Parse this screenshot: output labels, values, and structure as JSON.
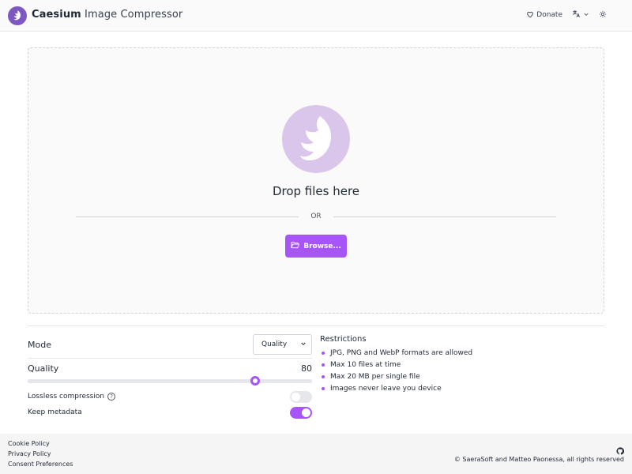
{
  "header": {
    "brand_strong": "Caesium",
    "brand_rest": " Image Compressor",
    "donate_label": "Donate",
    "icons": [
      "caesium-logo-icon",
      "heart-icon",
      "translate-icon",
      "chevron-down-icon",
      "theme-icon"
    ]
  },
  "dropzone": {
    "title": "Drop files here",
    "or_label": "OR",
    "browse_label": "Browse...",
    "icons": [
      "bird-logo-icon",
      "folder-open-icon"
    ]
  },
  "settings": {
    "mode_label": "Mode",
    "mode_value": "Quality",
    "quality_label": "Quality",
    "quality_value": "80",
    "quality_fraction": 0.8,
    "lossless_label": "Lossless compression",
    "lossless_on": false,
    "metadata_label": "Keep metadata",
    "metadata_on": true
  },
  "restrictions": {
    "title": "Restrictions",
    "items": [
      "JPG, PNG and WebP formats are allowed",
      "Max 10 files at time",
      "Max 20 MB per single file",
      "Images never leave you device"
    ]
  },
  "footer": {
    "links": [
      "Cookie Policy",
      "Privacy Policy",
      "Consent Preferences"
    ],
    "copyright": "© SaeraSoft and Matteo Paonessa, all rights reserved"
  },
  "colors": {
    "accent": "#a855f7",
    "logo_bg": "#7e57c2",
    "drop_circle": "#d9c6ea"
  }
}
